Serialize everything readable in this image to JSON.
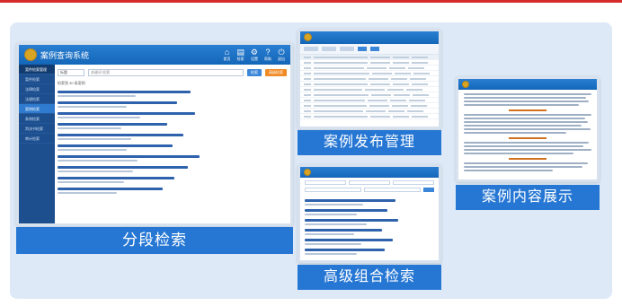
{
  "colors": {
    "accent": "#2677d4",
    "header": "#1466b8",
    "sidebar": "#1d4f8f",
    "top_line": "#d62b2b"
  },
  "screen1": {
    "app_title": "案例查询系统",
    "nav": [
      {
        "icon": "home-icon",
        "label": "首页"
      },
      {
        "icon": "document-icon",
        "label": "检索"
      },
      {
        "icon": "gear-icon",
        "label": "设置"
      },
      {
        "icon": "help-icon",
        "label": "帮助"
      },
      {
        "icon": "power-icon",
        "label": "退出"
      }
    ],
    "sidebar": [
      "案件检索管理",
      "案件检索",
      "法律检索",
      "法规检索",
      "案例检索",
      "条例检索",
      "判决书检索",
      "审计检索"
    ],
    "search": {
      "select": "标题",
      "placeholder": "关键词 检索",
      "btn_search": "检索",
      "btn_adv": "高级检索"
    },
    "result_count": "检索到 30 条案例",
    "caption": "分段检索"
  },
  "screen2": {
    "caption": "案例发布管理"
  },
  "screen3": {
    "caption": "高级组合检索"
  },
  "screen4": {
    "caption": "案例内容展示"
  }
}
